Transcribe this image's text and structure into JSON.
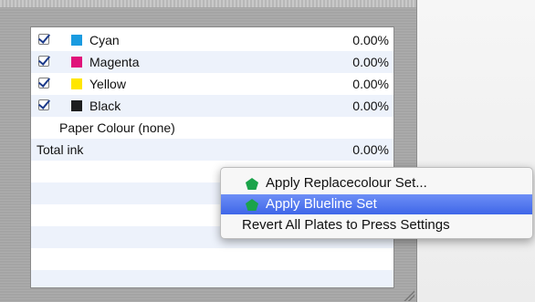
{
  "plates": [
    {
      "name": "Cyan",
      "value": "0.00%",
      "checked": true,
      "color": "#1a9be0"
    },
    {
      "name": "Magenta",
      "value": "0.00%",
      "checked": true,
      "color": "#e0127a"
    },
    {
      "name": "Yellow",
      "value": "0.00%",
      "checked": true,
      "color": "#ffe600"
    },
    {
      "name": "Black",
      "value": "0.00%",
      "checked": true,
      "color": "#1e1e1e"
    }
  ],
  "paper_colour": "Paper Colour (none)",
  "total": {
    "label": "Total ink",
    "value": "0.00%"
  },
  "context_menu": {
    "items": [
      {
        "label": "Apply Replacecolour Set...",
        "icon": "green-pentagon-icon",
        "selected": false
      },
      {
        "label": "Apply Blueline Set",
        "icon": "green-pentagon-icon",
        "selected": true
      },
      {
        "label": "Revert All Plates to Press Settings",
        "icon": null,
        "selected": false
      }
    ]
  },
  "colors": {
    "selection": "#4a6fea",
    "alt_row": "#edf2fb",
    "icon_green": "#1aa34a"
  }
}
